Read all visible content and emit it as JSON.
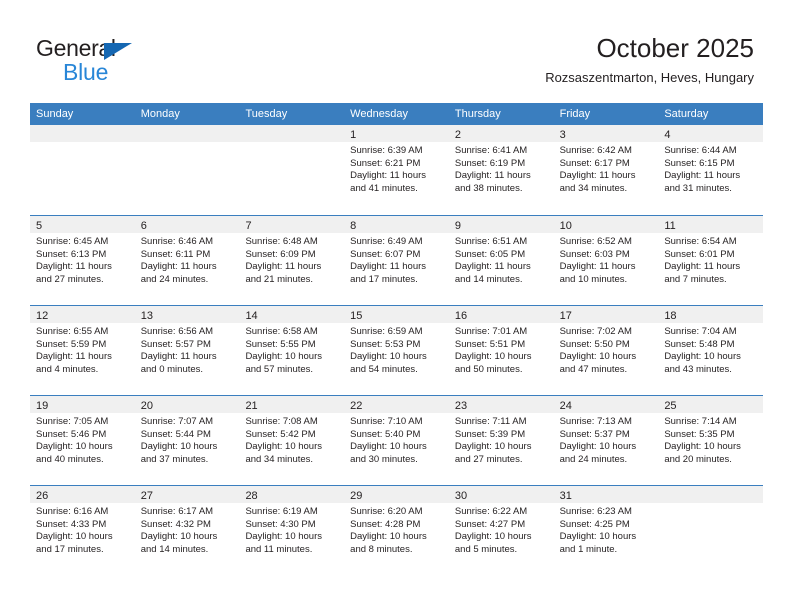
{
  "logo": {
    "word1": "General",
    "word2": "Blue",
    "triangle_color": "#1567b2",
    "blue_text_color": "#2886d7"
  },
  "header": {
    "title": "October 2025",
    "subtitle": "Rozsaszentmarton, Heves, Hungary",
    "accent_color": "#3a7ebf"
  },
  "calendar": {
    "weekdays": [
      "Sunday",
      "Monday",
      "Tuesday",
      "Wednesday",
      "Thursday",
      "Friday",
      "Saturday"
    ],
    "weeks": [
      [
        {
          "day": "",
          "lines": []
        },
        {
          "day": "",
          "lines": []
        },
        {
          "day": "",
          "lines": []
        },
        {
          "day": "1",
          "lines": [
            "Sunrise: 6:39 AM",
            "Sunset: 6:21 PM",
            "Daylight: 11 hours",
            "and 41 minutes."
          ]
        },
        {
          "day": "2",
          "lines": [
            "Sunrise: 6:41 AM",
            "Sunset: 6:19 PM",
            "Daylight: 11 hours",
            "and 38 minutes."
          ]
        },
        {
          "day": "3",
          "lines": [
            "Sunrise: 6:42 AM",
            "Sunset: 6:17 PM",
            "Daylight: 11 hours",
            "and 34 minutes."
          ]
        },
        {
          "day": "4",
          "lines": [
            "Sunrise: 6:44 AM",
            "Sunset: 6:15 PM",
            "Daylight: 11 hours",
            "and 31 minutes."
          ]
        }
      ],
      [
        {
          "day": "5",
          "lines": [
            "Sunrise: 6:45 AM",
            "Sunset: 6:13 PM",
            "Daylight: 11 hours",
            "and 27 minutes."
          ]
        },
        {
          "day": "6",
          "lines": [
            "Sunrise: 6:46 AM",
            "Sunset: 6:11 PM",
            "Daylight: 11 hours",
            "and 24 minutes."
          ]
        },
        {
          "day": "7",
          "lines": [
            "Sunrise: 6:48 AM",
            "Sunset: 6:09 PM",
            "Daylight: 11 hours",
            "and 21 minutes."
          ]
        },
        {
          "day": "8",
          "lines": [
            "Sunrise: 6:49 AM",
            "Sunset: 6:07 PM",
            "Daylight: 11 hours",
            "and 17 minutes."
          ]
        },
        {
          "day": "9",
          "lines": [
            "Sunrise: 6:51 AM",
            "Sunset: 6:05 PM",
            "Daylight: 11 hours",
            "and 14 minutes."
          ]
        },
        {
          "day": "10",
          "lines": [
            "Sunrise: 6:52 AM",
            "Sunset: 6:03 PM",
            "Daylight: 11 hours",
            "and 10 minutes."
          ]
        },
        {
          "day": "11",
          "lines": [
            "Sunrise: 6:54 AM",
            "Sunset: 6:01 PM",
            "Daylight: 11 hours",
            "and 7 minutes."
          ]
        }
      ],
      [
        {
          "day": "12",
          "lines": [
            "Sunrise: 6:55 AM",
            "Sunset: 5:59 PM",
            "Daylight: 11 hours",
            "and 4 minutes."
          ]
        },
        {
          "day": "13",
          "lines": [
            "Sunrise: 6:56 AM",
            "Sunset: 5:57 PM",
            "Daylight: 11 hours",
            "and 0 minutes."
          ]
        },
        {
          "day": "14",
          "lines": [
            "Sunrise: 6:58 AM",
            "Sunset: 5:55 PM",
            "Daylight: 10 hours",
            "and 57 minutes."
          ]
        },
        {
          "day": "15",
          "lines": [
            "Sunrise: 6:59 AM",
            "Sunset: 5:53 PM",
            "Daylight: 10 hours",
            "and 54 minutes."
          ]
        },
        {
          "day": "16",
          "lines": [
            "Sunrise: 7:01 AM",
            "Sunset: 5:51 PM",
            "Daylight: 10 hours",
            "and 50 minutes."
          ]
        },
        {
          "day": "17",
          "lines": [
            "Sunrise: 7:02 AM",
            "Sunset: 5:50 PM",
            "Daylight: 10 hours",
            "and 47 minutes."
          ]
        },
        {
          "day": "18",
          "lines": [
            "Sunrise: 7:04 AM",
            "Sunset: 5:48 PM",
            "Daylight: 10 hours",
            "and 43 minutes."
          ]
        }
      ],
      [
        {
          "day": "19",
          "lines": [
            "Sunrise: 7:05 AM",
            "Sunset: 5:46 PM",
            "Daylight: 10 hours",
            "and 40 minutes."
          ]
        },
        {
          "day": "20",
          "lines": [
            "Sunrise: 7:07 AM",
            "Sunset: 5:44 PM",
            "Daylight: 10 hours",
            "and 37 minutes."
          ]
        },
        {
          "day": "21",
          "lines": [
            "Sunrise: 7:08 AM",
            "Sunset: 5:42 PM",
            "Daylight: 10 hours",
            "and 34 minutes."
          ]
        },
        {
          "day": "22",
          "lines": [
            "Sunrise: 7:10 AM",
            "Sunset: 5:40 PM",
            "Daylight: 10 hours",
            "and 30 minutes."
          ]
        },
        {
          "day": "23",
          "lines": [
            "Sunrise: 7:11 AM",
            "Sunset: 5:39 PM",
            "Daylight: 10 hours",
            "and 27 minutes."
          ]
        },
        {
          "day": "24",
          "lines": [
            "Sunrise: 7:13 AM",
            "Sunset: 5:37 PM",
            "Daylight: 10 hours",
            "and 24 minutes."
          ]
        },
        {
          "day": "25",
          "lines": [
            "Sunrise: 7:14 AM",
            "Sunset: 5:35 PM",
            "Daylight: 10 hours",
            "and 20 minutes."
          ]
        }
      ],
      [
        {
          "day": "26",
          "lines": [
            "Sunrise: 6:16 AM",
            "Sunset: 4:33 PM",
            "Daylight: 10 hours",
            "and 17 minutes."
          ]
        },
        {
          "day": "27",
          "lines": [
            "Sunrise: 6:17 AM",
            "Sunset: 4:32 PM",
            "Daylight: 10 hours",
            "and 14 minutes."
          ]
        },
        {
          "day": "28",
          "lines": [
            "Sunrise: 6:19 AM",
            "Sunset: 4:30 PM",
            "Daylight: 10 hours",
            "and 11 minutes."
          ]
        },
        {
          "day": "29",
          "lines": [
            "Sunrise: 6:20 AM",
            "Sunset: 4:28 PM",
            "Daylight: 10 hours",
            "and 8 minutes."
          ]
        },
        {
          "day": "30",
          "lines": [
            "Sunrise: 6:22 AM",
            "Sunset: 4:27 PM",
            "Daylight: 10 hours",
            "and 5 minutes."
          ]
        },
        {
          "day": "31",
          "lines": [
            "Sunrise: 6:23 AM",
            "Sunset: 4:25 PM",
            "Daylight: 10 hours",
            "and 1 minute."
          ]
        },
        {
          "day": "",
          "lines": []
        }
      ]
    ]
  }
}
